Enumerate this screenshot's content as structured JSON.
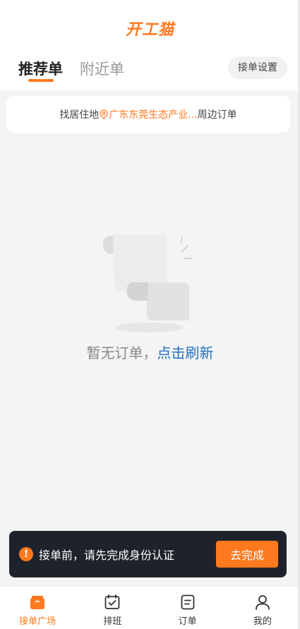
{
  "app": {
    "logo": "开工猫"
  },
  "tabs": [
    {
      "label": "推荐单",
      "active": true
    },
    {
      "label": "附近单",
      "active": false
    }
  ],
  "settings_label": "接单设置",
  "location": {
    "prefix": "找居住地",
    "address": "广东东莞生态产业...",
    "suffix": "周边订单"
  },
  "empty_state": {
    "text": "暂无订单，",
    "link": "点击刷新"
  },
  "notice": {
    "icon": "info-icon",
    "text": "接单前，请先完成身份认证",
    "button": "去完成"
  },
  "bottom_nav": [
    {
      "label": "接单广场",
      "icon": "briefcase-icon",
      "active": true
    },
    {
      "label": "排班",
      "icon": "calendar-check-icon",
      "active": false
    },
    {
      "label": "订单",
      "icon": "order-list-icon",
      "active": false
    },
    {
      "label": "我的",
      "icon": "person-icon",
      "active": false
    }
  ],
  "colors": {
    "accent": "#ff7a1f",
    "link": "#1f6fbf",
    "notice_bg": "#1e232b"
  }
}
